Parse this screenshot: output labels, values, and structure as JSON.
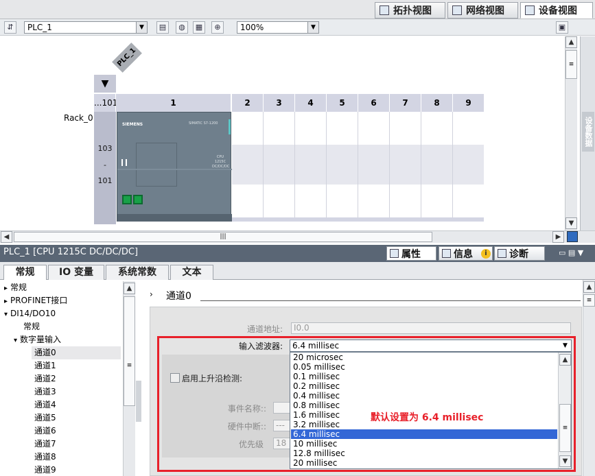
{
  "view_tabs": [
    {
      "label": "拓扑视图",
      "icon": "topology-icon"
    },
    {
      "label": "网络视图",
      "icon": "network-icon"
    },
    {
      "label": "设备视图",
      "icon": "device-icon"
    }
  ],
  "toolbar": {
    "device_select": "PLC_1",
    "zoom": "100%"
  },
  "rack": {
    "device_tag": "PLC_1",
    "rack_label": "Rack_0",
    "slot_headers": [
      "...101",
      "1",
      "2",
      "3",
      "4",
      "5",
      "6",
      "7",
      "8",
      "9"
    ],
    "side_numbers": [
      "103",
      "-",
      "101"
    ],
    "cpu_brand": "SIEMENS",
    "cpu_text": "SIMATIC S7-1200",
    "cpu_model": "CPU 1215C DC/DC/DC"
  },
  "side_tab": "设备数据",
  "panel": {
    "title": "PLC_1 [CPU 1215C DC/DC/DC]",
    "tabs": [
      "属性",
      "信息",
      "诊断"
    ]
  },
  "subtabs": [
    "常规",
    "IO 变量",
    "系统常数",
    "文本"
  ],
  "tree": [
    {
      "label": "常规",
      "indent": 0,
      "arrow": "▸"
    },
    {
      "label": "PROFINET接口",
      "indent": 0,
      "arrow": "▸"
    },
    {
      "label": "DI14/DO10",
      "indent": 0,
      "arrow": "▾"
    },
    {
      "label": "常规",
      "indent": 1,
      "arrow": ""
    },
    {
      "label": "数字量输入",
      "indent": 1,
      "arrow": "▾"
    },
    {
      "label": "通道0",
      "indent": 2,
      "arrow": "",
      "selected": true
    },
    {
      "label": "通道1",
      "indent": 2,
      "arrow": ""
    },
    {
      "label": "通道2",
      "indent": 2,
      "arrow": ""
    },
    {
      "label": "通道3",
      "indent": 2,
      "arrow": ""
    },
    {
      "label": "通道4",
      "indent": 2,
      "arrow": ""
    },
    {
      "label": "通道5",
      "indent": 2,
      "arrow": ""
    },
    {
      "label": "通道6",
      "indent": 2,
      "arrow": ""
    },
    {
      "label": "通道7",
      "indent": 2,
      "arrow": ""
    },
    {
      "label": "通道8",
      "indent": 2,
      "arrow": ""
    },
    {
      "label": "通道9",
      "indent": 2,
      "arrow": ""
    }
  ],
  "props": {
    "section": "通道0",
    "channel_address_label": "通道地址:",
    "channel_address_value": "I0.0",
    "filter_label": "输入滤波器:",
    "filter_value": "6.4 millisec",
    "rising_edge_label": "启用上升沿检测:",
    "event_name_label": "事件名称::",
    "hw_interrupt_label": "硬件中断::",
    "hw_interrupt_value": "---",
    "priority_label": "优先级",
    "priority_value": "18",
    "options": [
      "20 microsec",
      "0.05 millisec",
      "0.1 millisec",
      "0.2 millisec",
      "0.4 millisec",
      "0.8 millisec",
      "1.6 millisec",
      "3.2 millisec",
      "6.4 millisec",
      "10 millisec",
      "12.8 millisec",
      "20 millisec"
    ],
    "selected_option": "6.4 millisec",
    "annotation": "默认设置为 6.4 millisec"
  },
  "colors": {
    "annotation": "#e8202a",
    "selection": "#3367d6",
    "panel_header": "#5a6675"
  }
}
